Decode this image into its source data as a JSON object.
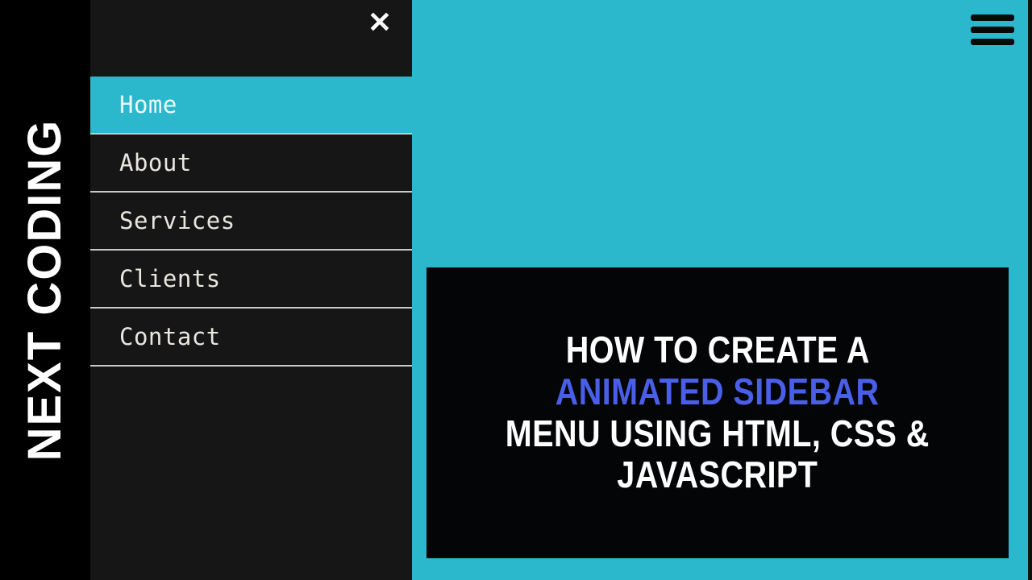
{
  "colors": {
    "teal_background": "#2bb8cd",
    "sidebar_background": "#161616",
    "brand_band_background": "#000000",
    "menu_divider": "#c9cbcb",
    "title_card_background": "#030507",
    "title_text": "#ffffff",
    "title_accent": "#4a5fe8",
    "hamburger_bar": "#060a0b"
  },
  "brand": {
    "text": "NEXT CODING"
  },
  "topbar": {
    "hamburger_icon": "hamburger-menu-icon"
  },
  "sidebar": {
    "close_icon": "✕",
    "close_icon_name": "close-icon",
    "items": [
      {
        "label": "Home",
        "active": true
      },
      {
        "label": "About",
        "active": false
      },
      {
        "label": "Services",
        "active": false
      },
      {
        "label": "Clients",
        "active": false
      },
      {
        "label": "Contact",
        "active": false
      }
    ]
  },
  "title_card": {
    "lines": [
      {
        "text": "HOW TO CREATE A",
        "accent": false
      },
      {
        "text": "ANIMATED SIDEBAR",
        "accent": true
      },
      {
        "text": "MENU USING HTML, CSS &",
        "accent": false
      },
      {
        "text": "JAVASCRIPT",
        "accent": false
      }
    ]
  }
}
